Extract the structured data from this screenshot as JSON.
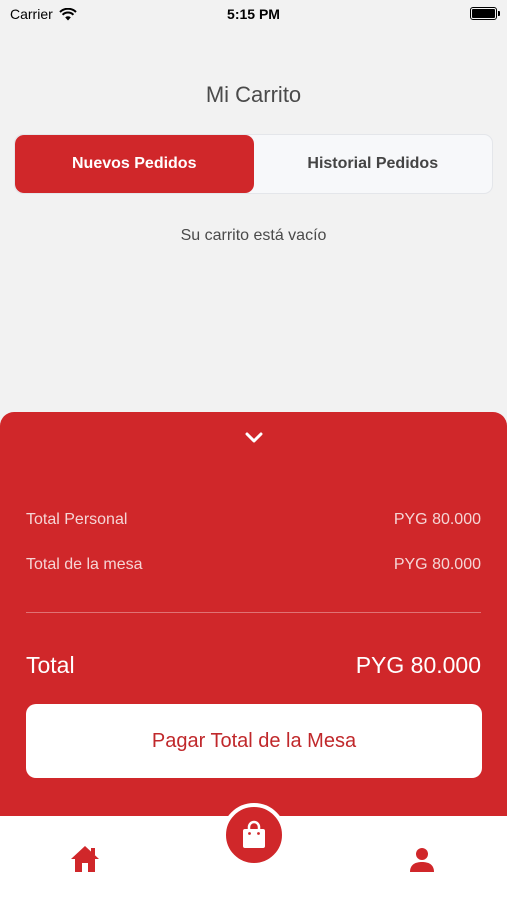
{
  "status_bar": {
    "carrier": "Carrier",
    "time": "5:15 PM"
  },
  "header": {
    "title": "Mi Carrito"
  },
  "tabs": [
    {
      "label": "Nuevos Pedidos",
      "active": true
    },
    {
      "label": "Historial Pedidos",
      "active": false
    }
  ],
  "cart": {
    "empty_message": "Su carrito está vacío"
  },
  "summary": {
    "personal_label": "Total Personal",
    "personal_value": "PYG 80.000",
    "table_label": "Total de la mesa",
    "table_value": "PYG 80.000",
    "total_label": "Total",
    "total_value": "PYG 80.000",
    "pay_button_label": "Pagar Total de la Mesa"
  },
  "tab_bar": {
    "items": [
      {
        "icon": "home-icon"
      },
      {
        "icon": "shopping-bag-icon"
      },
      {
        "icon": "user-icon"
      }
    ]
  },
  "colors": {
    "primary": "#d0272a",
    "background": "#f2f2f2"
  }
}
